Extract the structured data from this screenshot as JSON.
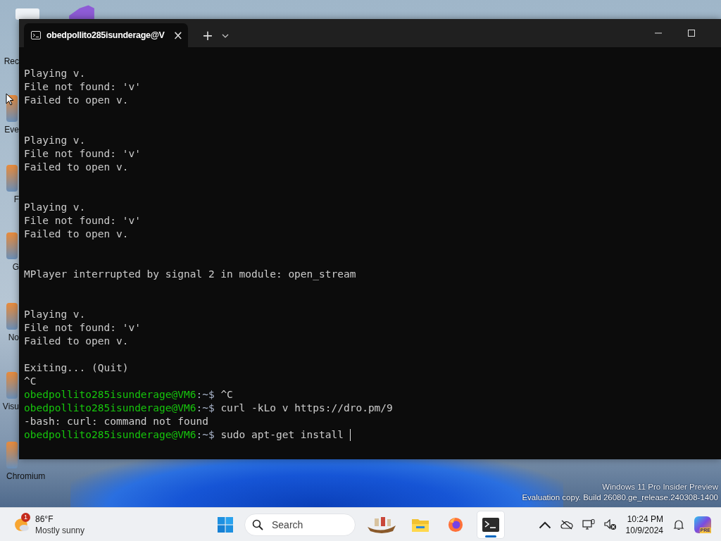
{
  "desktop": {
    "icons": [
      {
        "label": "Rec"
      },
      {
        "label": "Eve"
      },
      {
        "label": "F"
      },
      {
        "label": "G"
      },
      {
        "label": "No"
      },
      {
        "label": "Visu"
      },
      {
        "label": "Chromium"
      }
    ],
    "watermark": [
      "Windows 11 Pro Insider Preview",
      "Evaluation copy. Build 26080.ge_release.240308-1400"
    ]
  },
  "window": {
    "tab": {
      "title": "obedpollito285isunderage@V",
      "close": "×"
    },
    "new_tab": "+",
    "terminal": [
      {
        "lines": [
          {
            "kind": "output",
            "text": "Playing v."
          },
          {
            "kind": "output",
            "text": "File not found: 'v'"
          },
          {
            "kind": "output",
            "text": "Failed to open v."
          }
        ]
      },
      {
        "lines": [
          {
            "kind": "blank"
          },
          {
            "kind": "blank"
          },
          {
            "kind": "output",
            "text": "Playing v."
          },
          {
            "kind": "output",
            "text": "File not found: 'v'"
          },
          {
            "kind": "output",
            "text": "Failed to open v."
          }
        ]
      },
      {
        "lines": [
          {
            "kind": "blank"
          },
          {
            "kind": "blank"
          },
          {
            "kind": "output",
            "text": "Playing v."
          },
          {
            "kind": "output",
            "text": "File not found: 'v'"
          },
          {
            "kind": "output",
            "text": "Failed to open v."
          }
        ]
      },
      {
        "lines": [
          {
            "kind": "blank"
          },
          {
            "kind": "blank"
          },
          {
            "kind": "output",
            "text": "MPlayer interrupted by signal 2 in module: open_stream"
          }
        ]
      },
      {
        "lines": [
          {
            "kind": "blank"
          },
          {
            "kind": "blank"
          },
          {
            "kind": "output",
            "text": "Playing v."
          },
          {
            "kind": "output",
            "text": "File not found: 'v'"
          },
          {
            "kind": "output",
            "text": "Failed to open v."
          }
        ]
      },
      {
        "lines": [
          {
            "kind": "blank"
          },
          {
            "kind": "output",
            "text": "Exiting... (Quit)"
          },
          {
            "kind": "output",
            "text": "^C"
          },
          {
            "kind": "prompt",
            "user": "obedpollito285isunderage@VM6",
            "path": ":~$",
            "command": "^C",
            "cursor": false
          },
          {
            "kind": "prompt",
            "user": "obedpollito285isunderage@VM6",
            "path": ":~$",
            "command": "curl -kLo v https://dro.pm/9",
            "cursor": false
          },
          {
            "kind": "output",
            "text": "-bash: curl: command not found"
          },
          {
            "kind": "prompt",
            "user": "obedpollito285isunderage@VM6",
            "path": ":~$",
            "command": "sudo apt-get install ",
            "cursor": true
          }
        ]
      }
    ]
  },
  "taskbar": {
    "weather": {
      "badge": "1",
      "temperature": "86°F",
      "condition": "Mostly sunny"
    },
    "search": {
      "placeholder": "Search"
    },
    "apps": [
      {
        "kind": "ship",
        "active": false
      },
      {
        "kind": "folder",
        "active": false
      },
      {
        "kind": "browser",
        "active": false
      },
      {
        "kind": "terminal",
        "active": true
      }
    ],
    "clock": {
      "time": "10:24 PM",
      "date": "10/9/2024"
    },
    "copilot_badge": "PRE"
  }
}
